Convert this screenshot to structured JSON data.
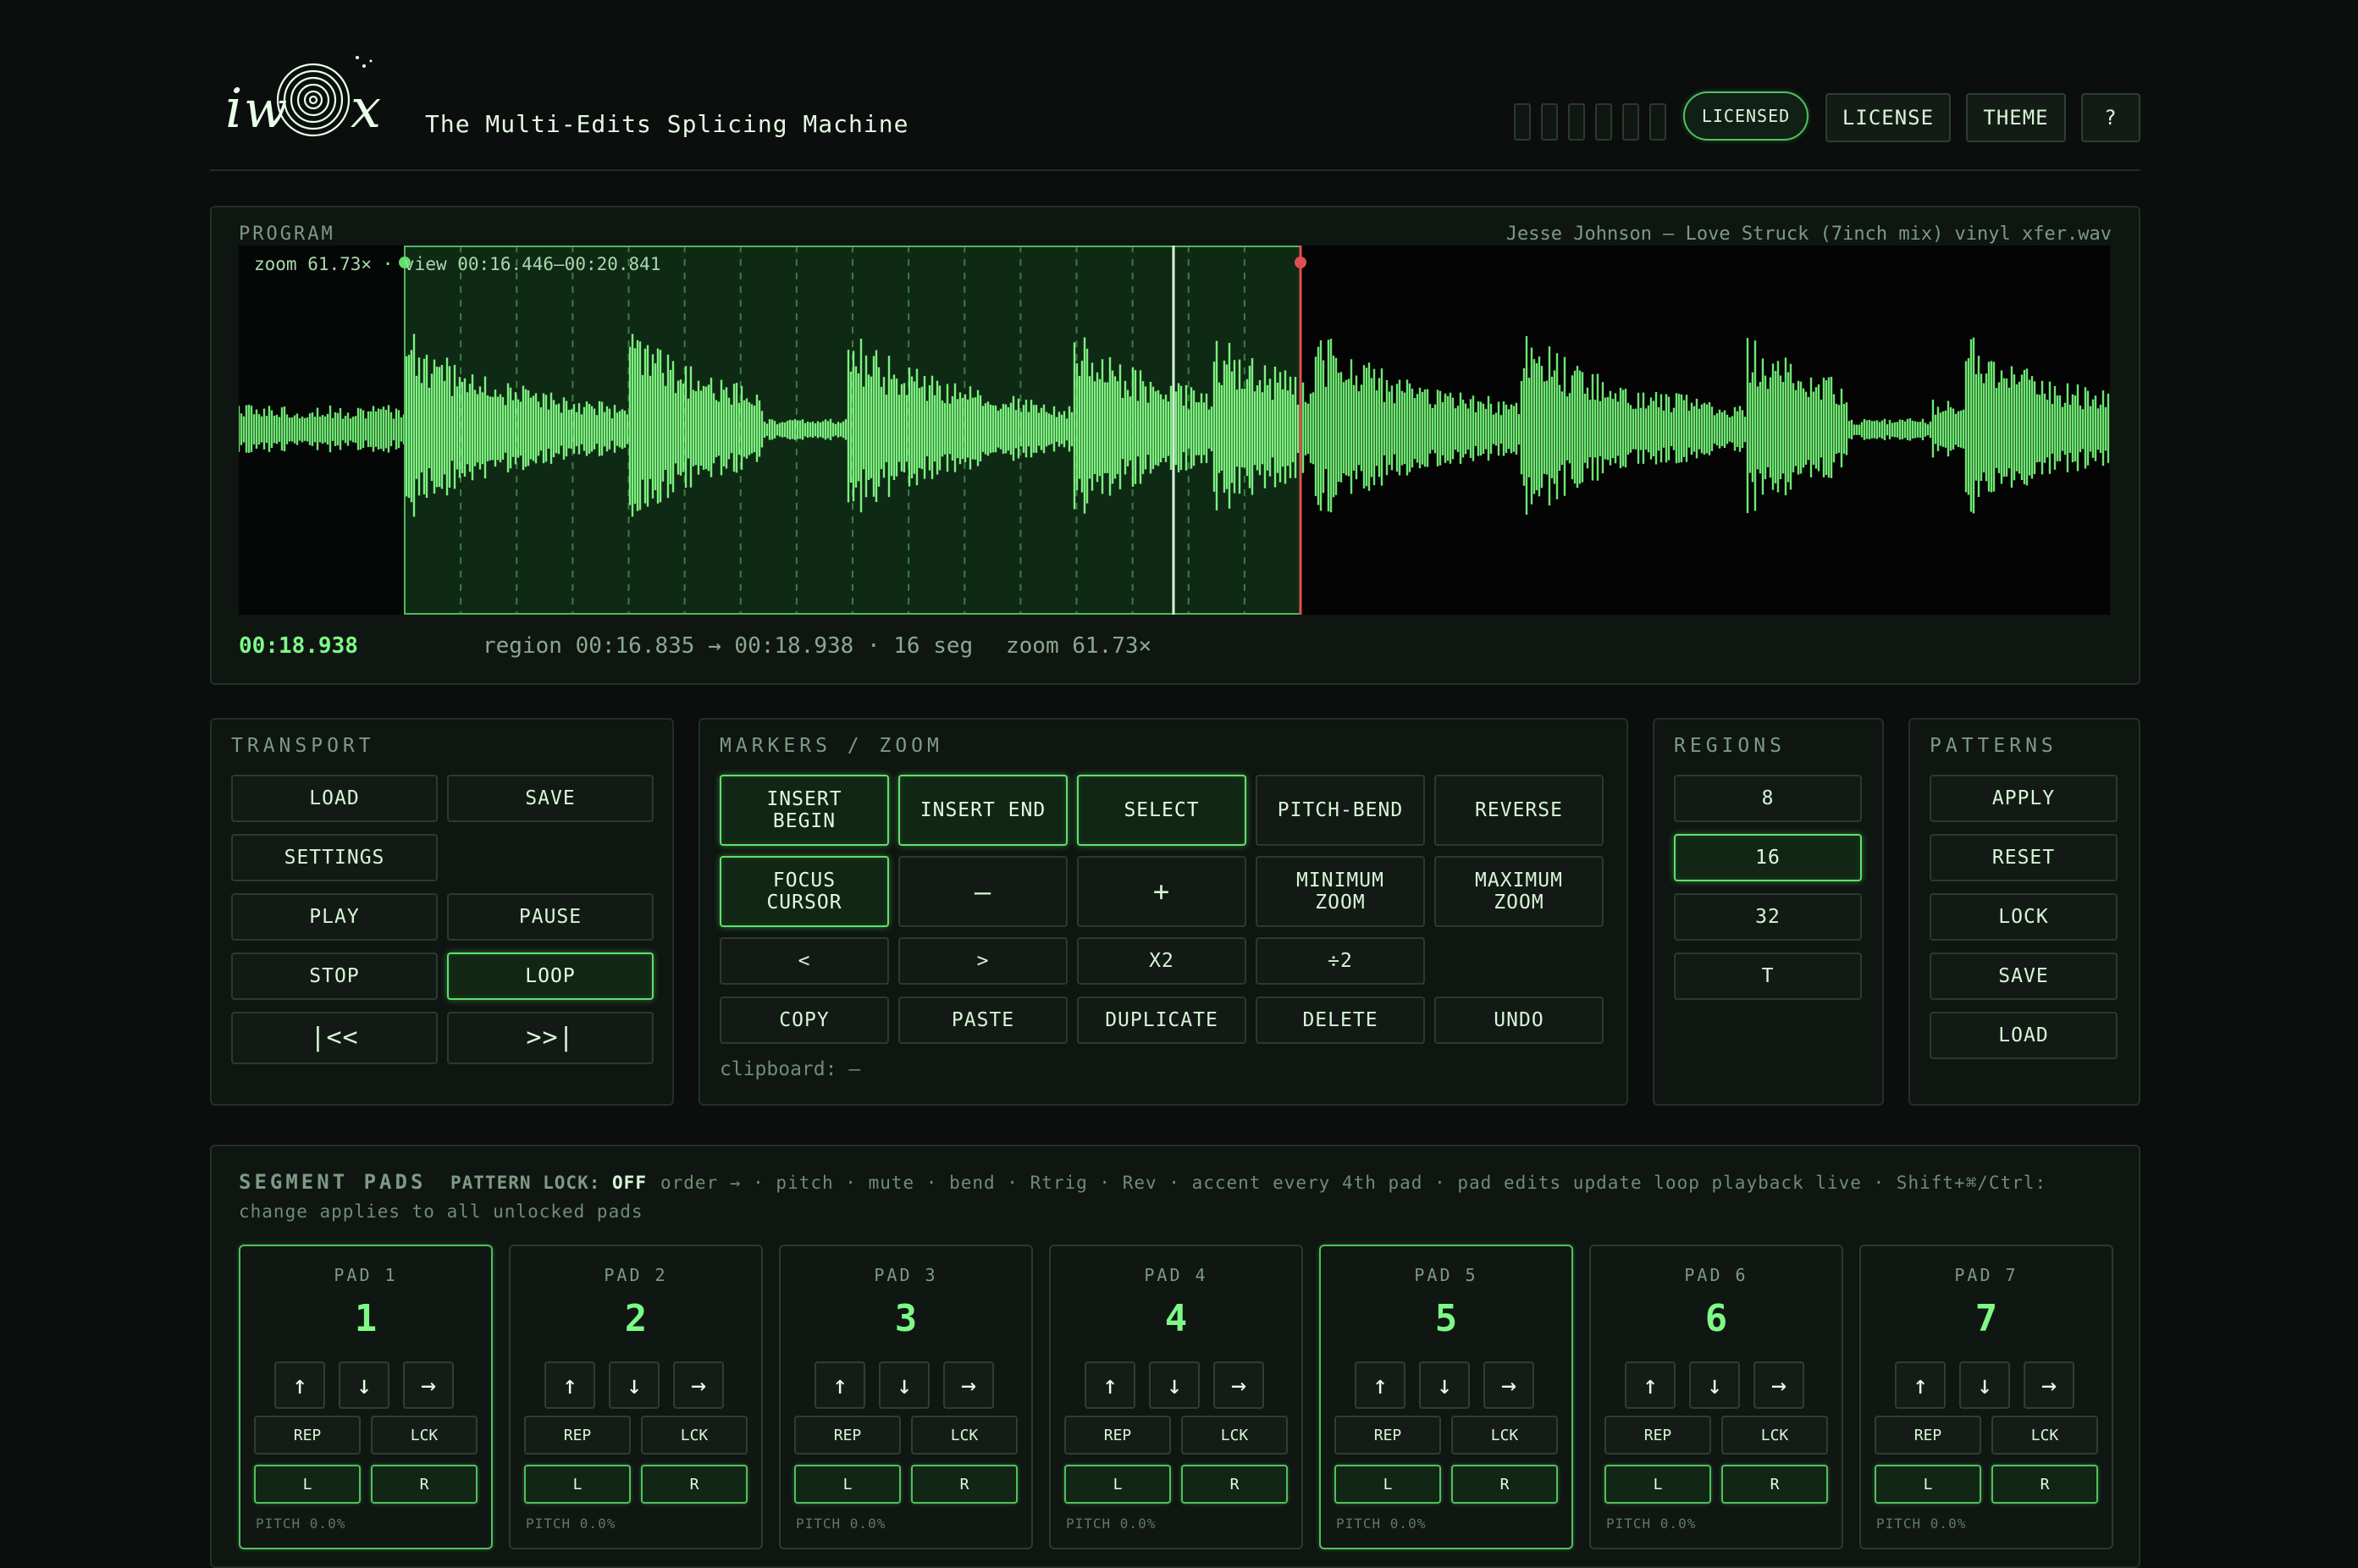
{
  "header": {
    "logo_text": "iwox",
    "subtitle": "The Multi-Edits Splicing Machine",
    "licensed_badge": "LICENSED",
    "license_btn": "LICENSE",
    "theme_btn": "THEME",
    "help_btn": "?",
    "meter_count": 6
  },
  "program": {
    "title": "PROGRAM",
    "filename": "Jesse Johnson – Love Struck (7inch mix) vinyl xfer.wav",
    "zoom_label": "zoom 61.73×",
    "view_label": "view 00:16.446–00:20.841",
    "time": "00:18.938",
    "region_info": "region 00:16.835 → 00:18.938 · 16 seg",
    "zoom_info": "zoom 61.73×"
  },
  "transport": {
    "title": "TRANSPORT",
    "load": "LOAD",
    "save": "SAVE",
    "settings": "SETTINGS",
    "play": "PLAY",
    "pause": "PAUSE",
    "stop": "STOP",
    "loop": "LOOP",
    "start": "|<<",
    "end": ">>|"
  },
  "markers": {
    "title": "MARKERS / ZOOM",
    "insert_begin": "INSERT\nBEGIN",
    "insert_end": "INSERT END",
    "select": "SELECT",
    "pitch_bend": "PITCH-BEND",
    "reverse": "REVERSE",
    "focus_cursor": "FOCUS\nCURSOR",
    "minus": "–",
    "plus": "+",
    "min_zoom": "MINIMUM\nZOOM",
    "max_zoom": "MAXIMUM\nZOOM",
    "left": "<",
    "right": ">",
    "x2": "X2",
    "div2": "÷2",
    "copy": "COPY",
    "paste": "PASTE",
    "duplicate": "DUPLICATE",
    "delete": "DELETE",
    "undo": "UNDO",
    "clipboard": "clipboard: —"
  },
  "regions": {
    "title": "REGIONS",
    "items": [
      "8",
      "16",
      "32",
      "T"
    ],
    "active": "16"
  },
  "patterns": {
    "title": "PATTERNS",
    "items": [
      "APPLY",
      "RESET",
      "LOCK",
      "SAVE",
      "LOAD"
    ]
  },
  "pads": {
    "title": "SEGMENT PADS",
    "lock_label": "PATTERN LOCK:",
    "lock_value": "OFF",
    "help": "order → · pitch · mute · bend · Rtrig · Rev · accent every 4th pad · pad edits update loop playback live · Shift+⌘/Ctrl:",
    "help2": "change applies to all unlocked pads",
    "items": [
      {
        "label": "PAD 1",
        "num": "1",
        "active": true
      },
      {
        "label": "PAD 2",
        "num": "2",
        "active": false
      },
      {
        "label": "PAD 3",
        "num": "3",
        "active": false
      },
      {
        "label": "PAD 4",
        "num": "4",
        "active": false
      },
      {
        "label": "PAD 5",
        "num": "5",
        "active": true
      },
      {
        "label": "PAD 6",
        "num": "6",
        "active": false
      },
      {
        "label": "PAD 7",
        "num": "7",
        "active": false
      }
    ],
    "up": "↑",
    "down": "↓",
    "right": "→",
    "rep": "REP",
    "lck": "LCK",
    "l": "L",
    "r": "R",
    "pitch": "PITCH 0.0%"
  },
  "colors": {
    "accent": "#5ee06a",
    "wave": "#7cf07f",
    "bg": "#0b0e0c",
    "cursor": "#e05050"
  }
}
